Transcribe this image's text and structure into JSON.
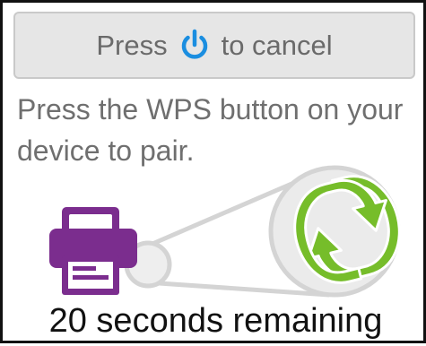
{
  "cancel": {
    "prefix": "Press",
    "icon": "power-icon",
    "suffix": "to cancel"
  },
  "instructions": {
    "text": "Press the WPS button on your device to pair."
  },
  "illustration": {
    "device_icon": "printer-icon",
    "router_icon": "wps-sync-icon"
  },
  "countdown": {
    "text": "20 seconds remaining"
  },
  "colors": {
    "accent": "#1b8ee0",
    "printer": "#7b2d8e",
    "wps": "#76bd2a",
    "belt": "#d4d4d4"
  }
}
